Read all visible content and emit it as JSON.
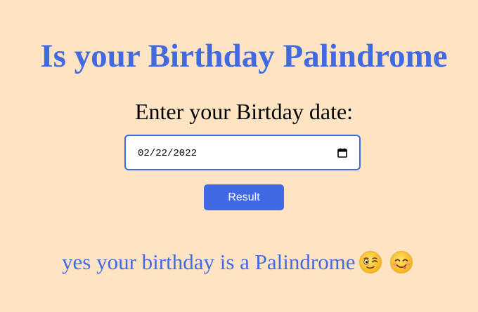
{
  "header": {
    "title": "Is your Birthday Palindrome"
  },
  "form": {
    "prompt": "Enter your Birtday date:",
    "date_value": "02/22/2022",
    "submit_label": "Result"
  },
  "result": {
    "message": "yes your birthday is a Palindrome",
    "emojis": [
      "winking-face-icon",
      "smiling-face-savoring-food-icon"
    ]
  },
  "colors": {
    "background": "#FFE4C4",
    "accent": "#4169E1",
    "text": "#000000",
    "input_background": "#FFFFFF"
  },
  "icons": {
    "date_picker": "calendar-icon"
  }
}
